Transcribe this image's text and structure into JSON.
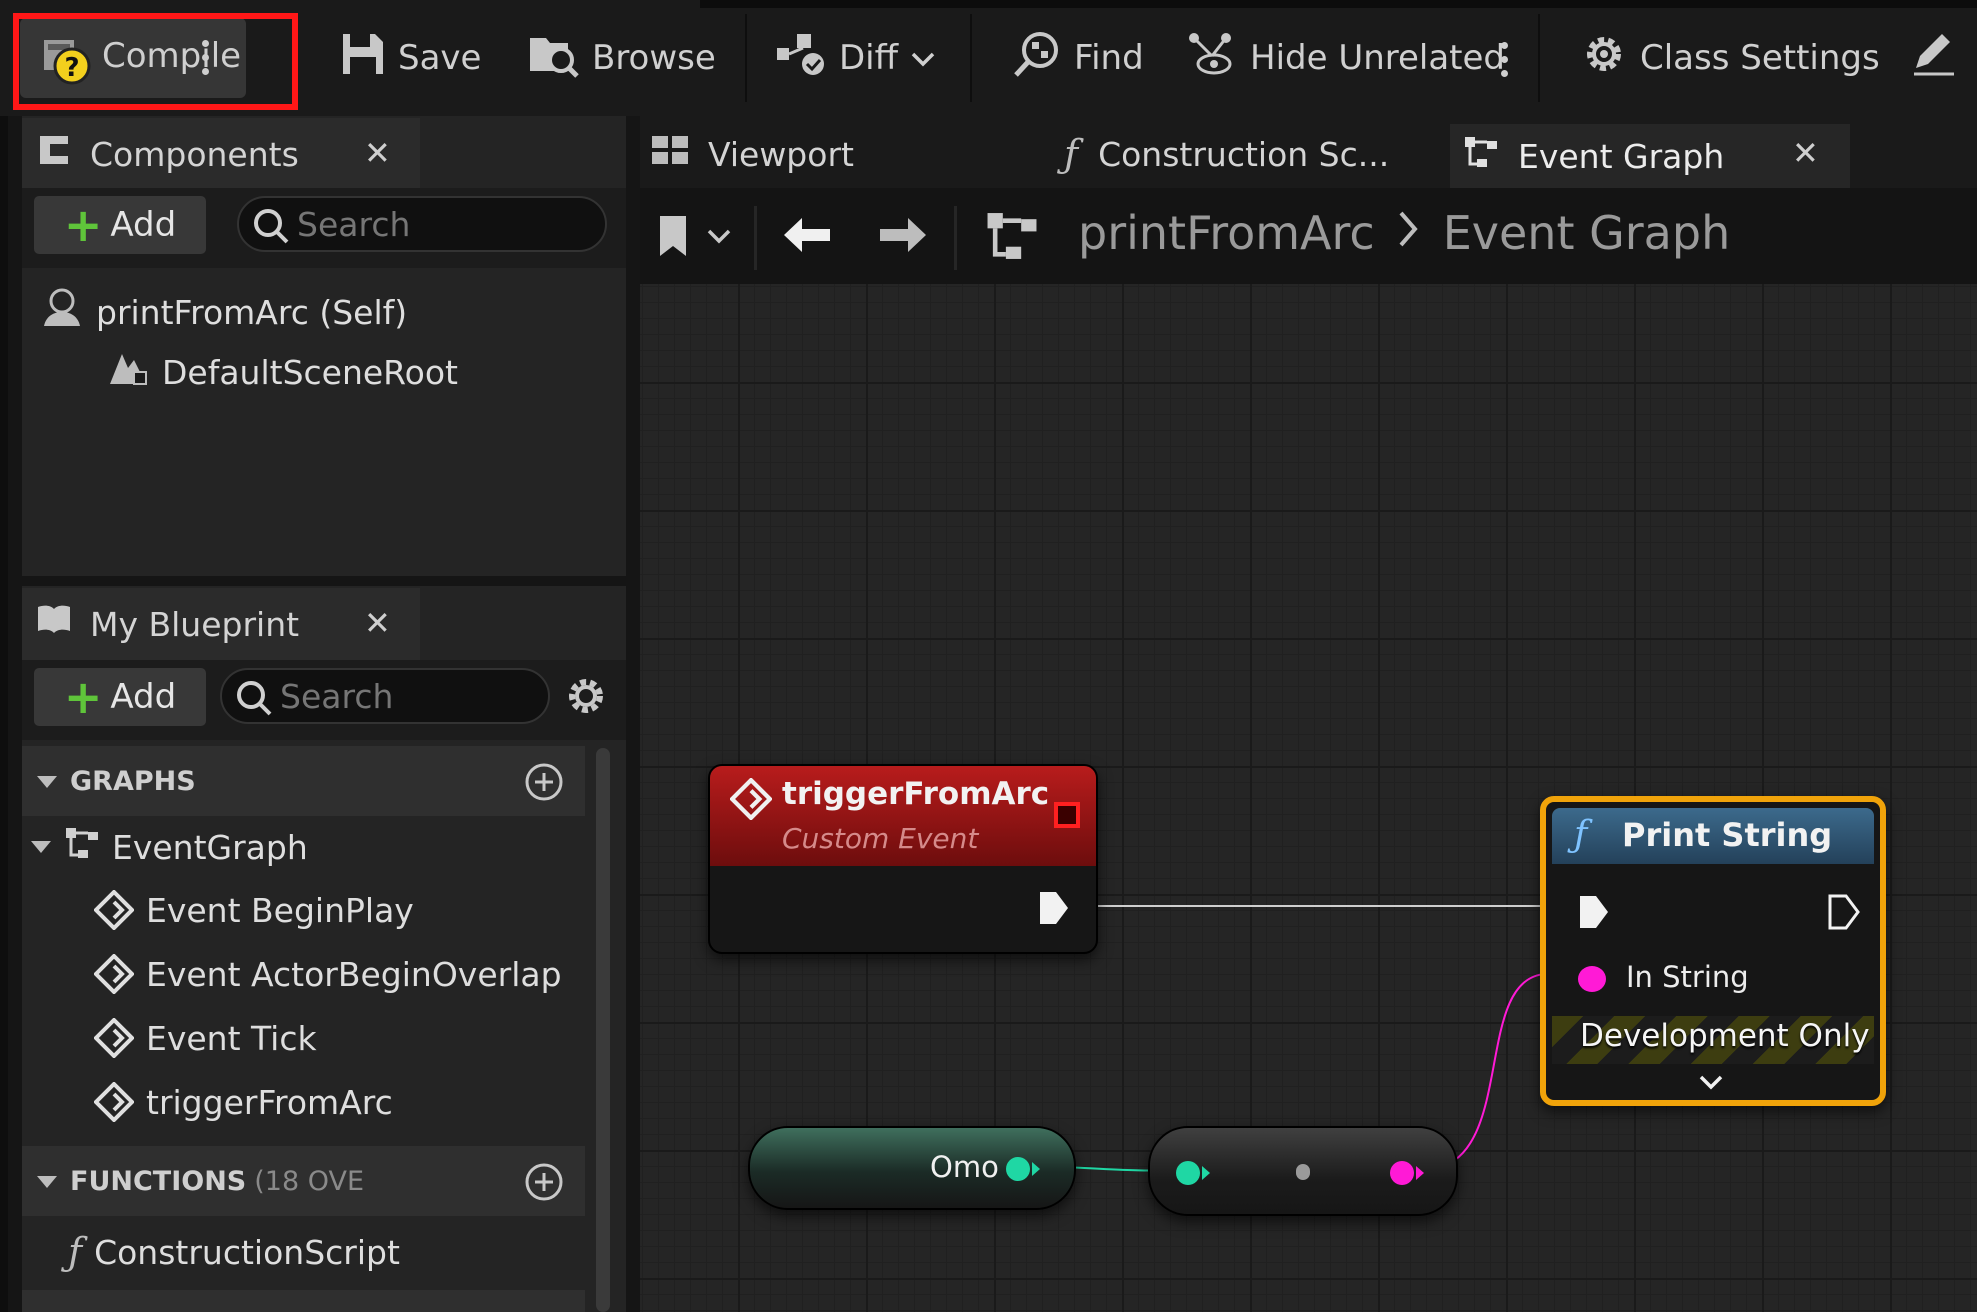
{
  "toolbar": {
    "compile": "Compile",
    "save": "Save",
    "browse": "Browse",
    "diff": "Diff",
    "find": "Find",
    "hide_unrelated": "Hide Unrelated",
    "class_settings": "Class Settings"
  },
  "tabs": {
    "components": "Components",
    "viewport": "Viewport",
    "construction": "Construction Sc...",
    "event_graph": "Event Graph",
    "my_blueprint": "My Blueprint"
  },
  "components_panel": {
    "add_label": "Add",
    "search_placeholder": "Search",
    "self_item": "printFromArc (Self)",
    "root_item": "DefaultSceneRoot"
  },
  "my_blueprint": {
    "add_label": "Add",
    "search_placeholder": "Search",
    "graphs_header": "GRAPHS",
    "event_graph": "EventGraph",
    "events": [
      "Event BeginPlay",
      "Event ActorBeginOverlap",
      "Event Tick",
      "triggerFromArc"
    ],
    "functions_header": "FUNCTIONS",
    "functions_count": "(18 OVE",
    "construction_script": "ConstructionScript"
  },
  "breadcrumb": {
    "asset": "printFromArc",
    "graph": "Event Graph"
  },
  "nodes": {
    "custom_event_title": "triggerFromArc",
    "custom_event_subtitle": "Custom Event",
    "print_string_title": "Print String",
    "in_string_label": "In String",
    "dev_only_label": "Development Only",
    "variable_label": "Omo"
  },
  "colors": {
    "highlight": "#ff1717",
    "event_node_header": "#8a1212",
    "function_node_header": "#2d4d67",
    "selection_outline": "#f0a30a",
    "string_pin": "#ff1ad6",
    "variable_pin": "#1fd7a4"
  }
}
